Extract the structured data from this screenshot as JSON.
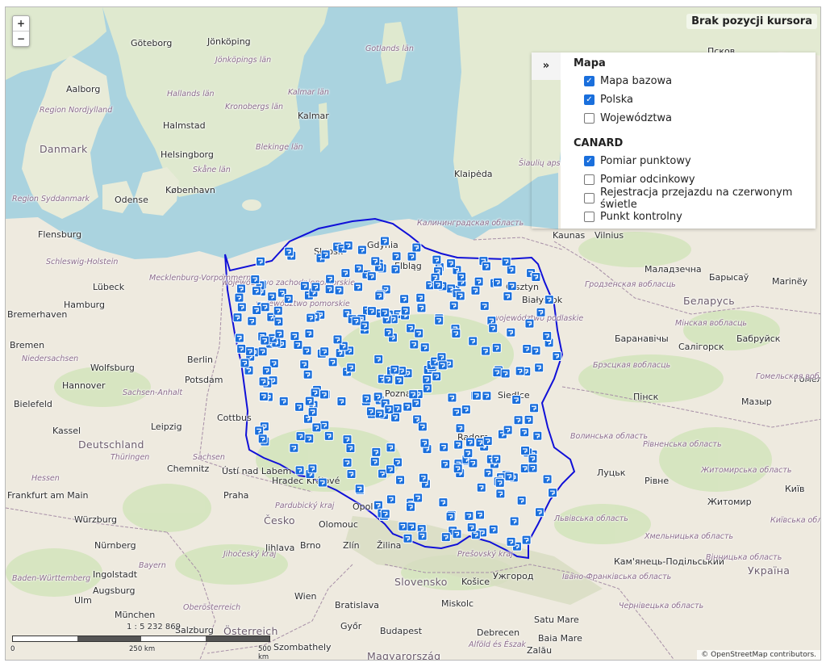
{
  "zoom": {
    "in_label": "+",
    "out_label": "−"
  },
  "cursor_status": "Brak pozycji kursora",
  "layers": {
    "toggle_label": "»",
    "groups": [
      {
        "title": "Mapa",
        "items": [
          {
            "label": "Mapa bazowa",
            "checked": true
          },
          {
            "label": "Polska",
            "checked": true
          },
          {
            "label": "Województwa",
            "checked": false
          }
        ]
      },
      {
        "title": "CANARD",
        "items": [
          {
            "label": "Pomiar punktowy",
            "checked": true
          },
          {
            "label": "Pomiar odcinkowy",
            "checked": false
          },
          {
            "label": "Rejestracja przejazdu na czerwonym świetle",
            "checked": false
          },
          {
            "label": "Punkt kontrolny",
            "checked": false
          }
        ]
      }
    ]
  },
  "scale": {
    "ratio": "1 : 5 232 869",
    "ticks": [
      "0",
      "250 km",
      "500 km"
    ]
  },
  "attribution": "© OpenStreetMap contributors.",
  "colors": {
    "border": "#1010d8",
    "marker": "#1a6fdc",
    "checkbox_on": "#1a6fdc",
    "water": "#aad3df",
    "land": "#eeeadf"
  },
  "map": {
    "cities": [
      {
        "name": "Göteborg"
      },
      {
        "name": "Jönköping"
      },
      {
        "name": "Aalborg"
      },
      {
        "name": "Halmstad"
      },
      {
        "name": "Kalmar"
      },
      {
        "name": "Helsingborg"
      },
      {
        "name": "København"
      },
      {
        "name": "Odense"
      },
      {
        "name": "Flensburg"
      },
      {
        "name": "Lübeck"
      },
      {
        "name": "Hamburg"
      },
      {
        "name": "Bremerhaven"
      },
      {
        "name": "Bremen"
      },
      {
        "name": "Berlin"
      },
      {
        "name": "Wolfsburg"
      },
      {
        "name": "Potsdam"
      },
      {
        "name": "Hannover"
      },
      {
        "name": "Bielefeld"
      },
      {
        "name": "Kassel"
      },
      {
        "name": "Leipzig"
      },
      {
        "name": "Chemnitz"
      },
      {
        "name": "Frankfurt am Main"
      },
      {
        "name": "Würzburg"
      },
      {
        "name": "Nürnberg"
      },
      {
        "name": "Ingolstadt"
      },
      {
        "name": "Augsburg"
      },
      {
        "name": "Ulm"
      },
      {
        "name": "München"
      },
      {
        "name": "Salzburg"
      },
      {
        "name": "Praha"
      },
      {
        "name": "Hradec Králové"
      },
      {
        "name": "Ústí nad Labem"
      },
      {
        "name": "Olomouc"
      },
      {
        "name": "Jihlava"
      },
      {
        "name": "Brno"
      },
      {
        "name": "Zlín"
      },
      {
        "name": "Žilina"
      },
      {
        "name": "Košice"
      },
      {
        "name": "Wien"
      },
      {
        "name": "Bratislava"
      },
      {
        "name": "Miskolc"
      },
      {
        "name": "Győr"
      },
      {
        "name": "Budapest"
      },
      {
        "name": "Debrecen"
      },
      {
        "name": "Szombathely"
      },
      {
        "name": "Satu Mare"
      },
      {
        "name": "Baia Mare"
      },
      {
        "name": "Zalău"
      },
      {
        "name": "Ужгород"
      },
      {
        "name": "Słupsk"
      },
      {
        "name": "Gdynia"
      },
      {
        "name": "Elbląg"
      },
      {
        "name": "Klaipėda"
      },
      {
        "name": "Kaunas"
      },
      {
        "name": "Vilnius"
      },
      {
        "name": "Маладзечна"
      },
      {
        "name": "Барысаў"
      },
      {
        "name": "Marinëy"
      },
      {
        "name": "Баранавічы"
      },
      {
        "name": "Салігорск"
      },
      {
        "name": "Бабруйск"
      },
      {
        "name": "Гомель"
      },
      {
        "name": "Пінск"
      },
      {
        "name": "Мазыр"
      },
      {
        "name": "Siedlce"
      },
      {
        "name": "Луцьк"
      },
      {
        "name": "Рівне"
      },
      {
        "name": "Житомир"
      },
      {
        "name": "Київ"
      },
      {
        "name": "Кам'янець-Подільський"
      },
      {
        "name": "Псков"
      },
      {
        "name": "Cottbus"
      },
      {
        "name": "Radom"
      },
      {
        "name": "Poznań"
      },
      {
        "name": "Opole"
      },
      {
        "name": "Olsztyn"
      },
      {
        "name": "Białystok"
      }
    ],
    "countries": [
      {
        "name": "Danmark"
      },
      {
        "name": "Deutschland"
      },
      {
        "name": "Česko"
      },
      {
        "name": "Slovensko"
      },
      {
        "name": "Österreich"
      },
      {
        "name": "Magyarország"
      },
      {
        "name": "Беларусь"
      },
      {
        "name": "Україна"
      }
    ],
    "regions": [
      {
        "name": "Region Nordjylland"
      },
      {
        "name": "Hallands län"
      },
      {
        "name": "Kronobergs län"
      },
      {
        "name": "Kalmar län"
      },
      {
        "name": "Skåne län"
      },
      {
        "name": "Blekinge län"
      },
      {
        "name": "Region Syddanmark"
      },
      {
        "name": "Schleswig-Holstein"
      },
      {
        "name": "Mecklenburg-Vorpommern"
      },
      {
        "name": "Niedersachsen"
      },
      {
        "name": "Sachsen-Anhalt"
      },
      {
        "name": "Thüringen"
      },
      {
        "name": "Sachsen"
      },
      {
        "name": "Hessen"
      },
      {
        "name": "Bayern"
      },
      {
        "name": "Baden-Württemberg"
      },
      {
        "name": "Oberösterreich"
      },
      {
        "name": "Калининградская область"
      },
      {
        "name": "Šiaulių apskritis"
      },
      {
        "name": "Гродзенская вобласць"
      },
      {
        "name": "Мінская вобласць"
      },
      {
        "name": "Брэсцкая вобласць"
      },
      {
        "name": "Гомельская вобласць"
      },
      {
        "name": "Волинська область"
      },
      {
        "name": "Рівненська область"
      },
      {
        "name": "Житомирська область"
      },
      {
        "name": "Київська область"
      },
      {
        "name": "Львівська область"
      },
      {
        "name": "Хмельницька область"
      },
      {
        "name": "Вінницька область"
      },
      {
        "name": "Івано-Франківська область"
      },
      {
        "name": "Чернівецька область"
      },
      {
        "name": "Prešovský kraj"
      },
      {
        "name": "Alföld és Észak"
      },
      {
        "name": "Pardubický kraj"
      },
      {
        "name": "Jihočeský kraj"
      },
      {
        "name": "województwo pomorskie"
      },
      {
        "name": "województwo podlaskie"
      },
      {
        "name": "województwo zachodniopomorskie"
      }
    ],
    "seas": [
      {
        "name": "Jönköpings län"
      },
      {
        "name": "Gotlands län"
      }
    ]
  }
}
